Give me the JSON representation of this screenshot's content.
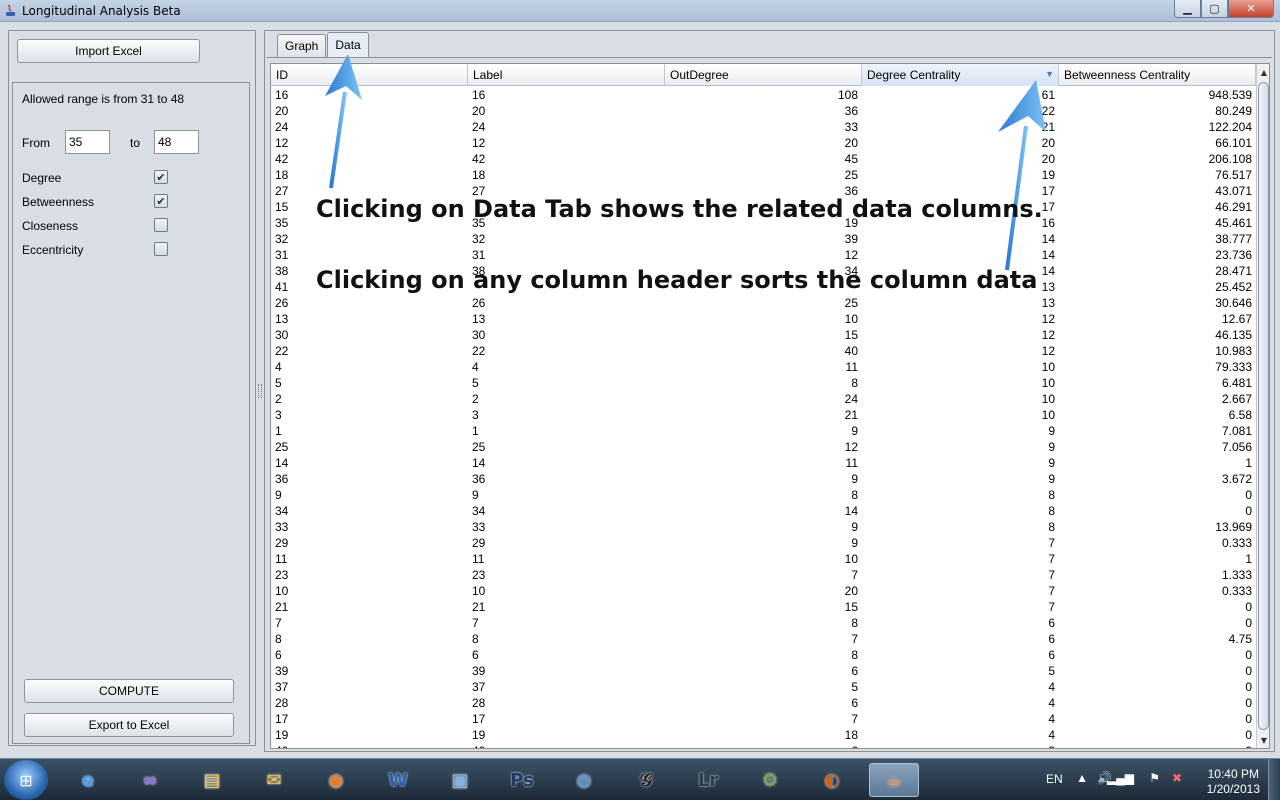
{
  "window": {
    "title": "Longitudinal Analysis Beta"
  },
  "left": {
    "import_label": "Import Excel",
    "range_text": "Allowed range is from 31 to 48",
    "from_label": "From",
    "from_value": "35",
    "to_label": "to",
    "to_value": "48",
    "checks": [
      {
        "label": "Degree",
        "checked": true
      },
      {
        "label": "Betweenness",
        "checked": true
      },
      {
        "label": "Closeness",
        "checked": false
      },
      {
        "label": "Eccentricity",
        "checked": false
      }
    ],
    "compute_label": "COMPUTE",
    "export_label": "Export to Excel"
  },
  "tabs": [
    {
      "label": "Graph"
    },
    {
      "label": "Data",
      "active": true
    }
  ],
  "table": {
    "headers": [
      "ID",
      "Label",
      "OutDegree",
      "Degree Centrality",
      "Betweenness Centrality"
    ],
    "sorted_column": 3,
    "rows": [
      [
        "16",
        "16",
        "108",
        "61",
        "948.539"
      ],
      [
        "20",
        "20",
        "36",
        "22",
        "80.249"
      ],
      [
        "24",
        "24",
        "33",
        "21",
        "122.204"
      ],
      [
        "12",
        "12",
        "20",
        "20",
        "66.101"
      ],
      [
        "42",
        "42",
        "45",
        "20",
        "206.108"
      ],
      [
        "18",
        "18",
        "25",
        "19",
        "76.517"
      ],
      [
        "27",
        "27",
        "36",
        "17",
        "43.071"
      ],
      [
        "15",
        "",
        "",
        "17",
        "46.291"
      ],
      [
        "35",
        "35",
        "19",
        "16",
        "45.461"
      ],
      [
        "32",
        "32",
        "39",
        "14",
        "38.777"
      ],
      [
        "31",
        "31",
        "12",
        "14",
        "23.736"
      ],
      [
        "38",
        "38",
        "34",
        "14",
        "28.471"
      ],
      [
        "41",
        "",
        "",
        "13",
        "25.452"
      ],
      [
        "26",
        "26",
        "25",
        "13",
        "30.646"
      ],
      [
        "13",
        "13",
        "10",
        "12",
        "12.67"
      ],
      [
        "30",
        "30",
        "15",
        "12",
        "46.135"
      ],
      [
        "22",
        "22",
        "40",
        "12",
        "10.983"
      ],
      [
        "4",
        "4",
        "11",
        "10",
        "79.333"
      ],
      [
        "5",
        "5",
        "8",
        "10",
        "6.481"
      ],
      [
        "2",
        "2",
        "24",
        "10",
        "2.667"
      ],
      [
        "3",
        "3",
        "21",
        "10",
        "6.58"
      ],
      [
        "1",
        "1",
        "9",
        "9",
        "7.081"
      ],
      [
        "25",
        "25",
        "12",
        "9",
        "7.056"
      ],
      [
        "14",
        "14",
        "11",
        "9",
        "1"
      ],
      [
        "36",
        "36",
        "9",
        "9",
        "3.672"
      ],
      [
        "9",
        "9",
        "8",
        "8",
        "0"
      ],
      [
        "34",
        "34",
        "14",
        "8",
        "0"
      ],
      [
        "33",
        "33",
        "9",
        "8",
        "13.969"
      ],
      [
        "29",
        "29",
        "9",
        "7",
        "0.333"
      ],
      [
        "11",
        "11",
        "10",
        "7",
        "1"
      ],
      [
        "23",
        "23",
        "7",
        "7",
        "1.333"
      ],
      [
        "10",
        "10",
        "20",
        "7",
        "0.333"
      ],
      [
        "21",
        "21",
        "15",
        "7",
        "0"
      ],
      [
        "7",
        "7",
        "8",
        "6",
        "0"
      ],
      [
        "8",
        "8",
        "7",
        "6",
        "4.75"
      ],
      [
        "6",
        "6",
        "8",
        "6",
        "0"
      ],
      [
        "39",
        "39",
        "6",
        "5",
        "0"
      ],
      [
        "37",
        "37",
        "5",
        "4",
        "0"
      ],
      [
        "28",
        "28",
        "6",
        "4",
        "0"
      ],
      [
        "17",
        "17",
        "7",
        "4",
        "0"
      ],
      [
        "19",
        "19",
        "18",
        "4",
        "0"
      ],
      [
        "40",
        "40",
        "6",
        "3",
        "0"
      ]
    ]
  },
  "annotations": {
    "line1": "Clicking on Data Tab shows the related data columns.",
    "line2": "Clicking on any column header sorts the column data",
    "arrow_color": "#4a9ee8"
  },
  "taskbar": {
    "icons": [
      {
        "name": "ie-icon",
        "glyph": "e",
        "color": "#3fa0ff"
      },
      {
        "name": "visual-studio-icon",
        "glyph": "∞",
        "color": "#8a6bd9"
      },
      {
        "name": "file-explorer-icon",
        "glyph": "▤",
        "color": "#f2c55c"
      },
      {
        "name": "outlook-icon",
        "glyph": "✉",
        "color": "#f0c040"
      },
      {
        "name": "firefox-icon",
        "glyph": "◉",
        "color": "#f07a20"
      },
      {
        "name": "word-icon",
        "glyph": "W",
        "color": "#2b5fb4"
      },
      {
        "name": "virtualbox-icon",
        "glyph": "▣",
        "color": "#7fb2e5"
      },
      {
        "name": "photoshop-icon",
        "glyph": "Ps",
        "color": "#1b3a66"
      },
      {
        "name": "google-earth-icon",
        "glyph": "◍",
        "color": "#4a8fd8"
      },
      {
        "name": "script-font-icon",
        "glyph": "𝒢",
        "color": "#222222"
      },
      {
        "name": "lightroom-icon",
        "glyph": "Lr",
        "color": "#2a3b4c"
      },
      {
        "name": "network-tool-icon",
        "glyph": "⚙",
        "color": "#7aa040"
      },
      {
        "name": "paint-icon",
        "glyph": "◐",
        "color": "#d06020"
      },
      {
        "name": "java-icon",
        "glyph": "☕",
        "color": "#e07020"
      }
    ],
    "lang": "EN",
    "time": "10:40 PM",
    "date": "1/20/2013"
  }
}
